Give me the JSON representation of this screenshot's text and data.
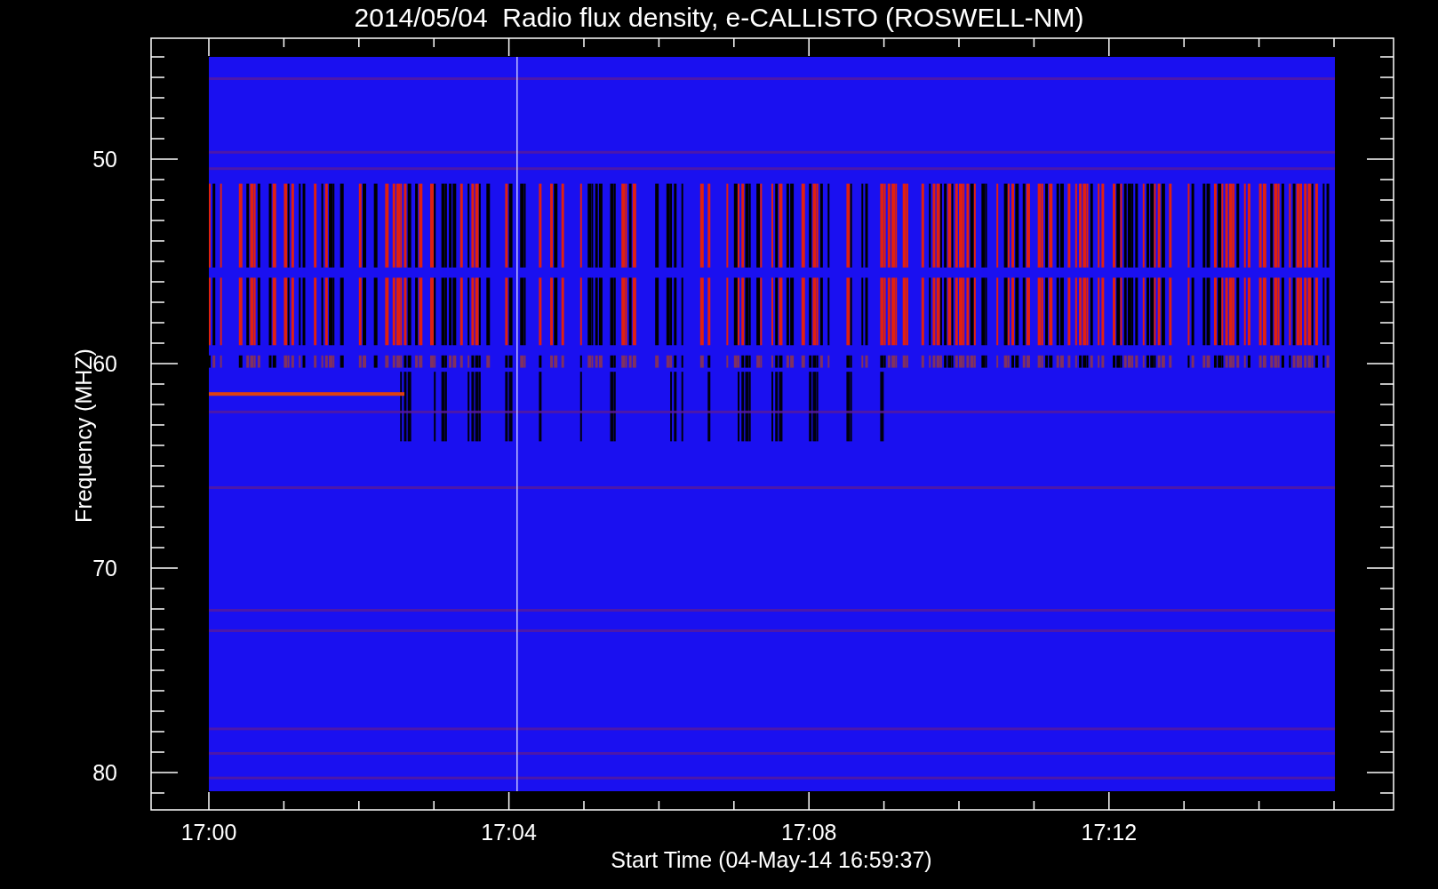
{
  "plot": {
    "title": "2014/05/04  Radio flux density, e-CALLISTO (ROSWELL-NM)",
    "y_axis": {
      "label": "Frequency (MHZ)",
      "tick_labels": [
        "50",
        "60",
        "70",
        "80"
      ]
    },
    "x_axis": {
      "label": "Start Time (04-May-14 16:59:37)",
      "tick_labels": [
        "17:00",
        "17:04",
        "17:08",
        "17:12"
      ]
    }
  }
}
